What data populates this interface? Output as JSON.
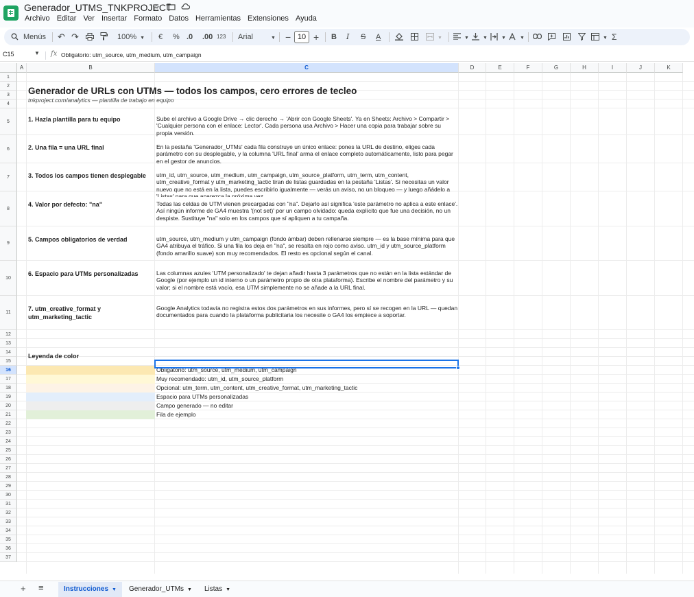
{
  "window": {
    "title": "Generador_UTMS_TNKPROJECT",
    "menu": [
      "Archivo",
      "Editar",
      "Ver",
      "Insertar",
      "Formato",
      "Datos",
      "Herramientas",
      "Extensiones",
      "Ayuda"
    ]
  },
  "toolbar": {
    "search_label": "Menús",
    "zoom": "100%",
    "currency": "€",
    "percent": "%",
    "dec_decrease": ".0",
    "dec_increase": ".00",
    "number_format": "123",
    "font_name": "Arial",
    "font_size": "10",
    "bold": "B",
    "italic": "I",
    "strike": "S",
    "text_color": "A",
    "sum": "Σ"
  },
  "formula_bar": {
    "cell_ref": "C15",
    "content": "Obligatorio: utm_source, utm_medium, utm_campaign"
  },
  "grid": {
    "columns": [
      "A",
      "B",
      "C",
      "D",
      "E",
      "F",
      "G",
      "H",
      "I",
      "J",
      "K"
    ],
    "active_column": "C",
    "active_row": "16"
  },
  "sheet": {
    "title": "Generador de URLs con UTMs — todos los campos, cero errores de tecleo",
    "subtitle": "tnkproject.com/analytics — plantilla de trabajo en equipo",
    "steps": [
      {
        "title": "1. Hazla plantilla para tu equipo",
        "desc": "Sube el archivo a Google Drive → clic derecho → 'Abrir con Google Sheets'. Ya en Sheets: Archivo > Compartir > 'Cualquier persona con el enlace: Lector'. Cada persona usa Archivo > Hacer una copia para trabajar sobre su propia versión."
      },
      {
        "title": "2. Una fila = una URL final",
        "desc": "En la pestaña 'Generador_UTMs' cada fila construye un único enlace: pones la URL de destino, eliges cada parámetro con su desplegable, y la columna 'URL final' arma el enlace completo automáticamente, listo para pegar en el gestor de anuncios."
      },
      {
        "title": "3. Todos los campos tienen desplegable",
        "desc": "utm_id, utm_source, utm_medium, utm_campaign, utm_source_platform, utm_term, utm_content, utm_creative_format y utm_marketing_tactic tiran de listas guardadas en la pestaña 'Listas'. Si necesitas un valor nuevo que no está en la lista, puedes escribirlo igualmente — verás un aviso, no un bloqueo — y luego añádelo a 'Listas' para que aparezca la próxima vez."
      },
      {
        "title": "4. Valor por defecto: \"na\"",
        "desc": "Todas las celdas de UTM vienen precargadas con \"na\". Dejarlo así significa 'este parámetro no aplica a este enlace'. Así ningún informe de GA4 muestra '(not set)' por un campo olvidado: queda explícito que fue una decisión, no un despiste. Sustituye \"na\" solo en los campos que sí apliquen a tu campaña."
      },
      {
        "title": "5. Campos obligatorios de verdad",
        "desc": "utm_source, utm_medium y utm_campaign (fondo ámbar) deben rellenarse siempre — es la base mínima para que GA4 atribuya el tráfico. Si una fila los deja en \"na\", se resalta en rojo como aviso. utm_id y utm_source_platform (fondo amarillo suave) son muy recomendados. El resto es opcional según el canal."
      },
      {
        "title": "6. Espacio para UTMs personalizadas",
        "desc": "Las columnas azules 'UTM personalizado' te dejan añadir hasta 3 parámetros que no están en la lista estándar de Google (por ejemplo un id interno o un parámetro propio de otra plataforma). Escribe el nombre del parámetro y su valor; si el nombre está vacío, esa UTM simplemente no se añade a la URL final."
      },
      {
        "title": "7. utm_creative_format y utm_marketing_tactic",
        "desc": "Google Analytics todavía no registra estos dos parámetros en sus informes, pero sí se recogen en la URL — quedan documentados para cuando la plataforma publicitaria los necesite o GA4 los empiece a soportar."
      }
    ],
    "legend": {
      "title": "Leyenda de color",
      "items": [
        {
          "color": "#fce8b2",
          "label": "Obligatorio: utm_source, utm_medium, utm_campaign"
        },
        {
          "color": "#fff8d6",
          "label": "Muy recomendado: utm_id, utm_source_platform"
        },
        {
          "color": "#fdf3e6",
          "label": "Opcional: utm_term, utm_content, utm_creative_format, utm_marketing_tactic"
        },
        {
          "color": "#e3eefb",
          "label": "Espacio para UTMs personalizadas"
        },
        {
          "color": "#eeeeee",
          "label": "Campo generado — no editar"
        },
        {
          "color": "#e2f0d9",
          "label": "Fila de ejemplo"
        }
      ]
    }
  },
  "tabs": [
    {
      "label": "Instrucciones",
      "active": true
    },
    {
      "label": "Generador_UTMs",
      "active": false
    },
    {
      "label": "Listas",
      "active": false
    }
  ]
}
